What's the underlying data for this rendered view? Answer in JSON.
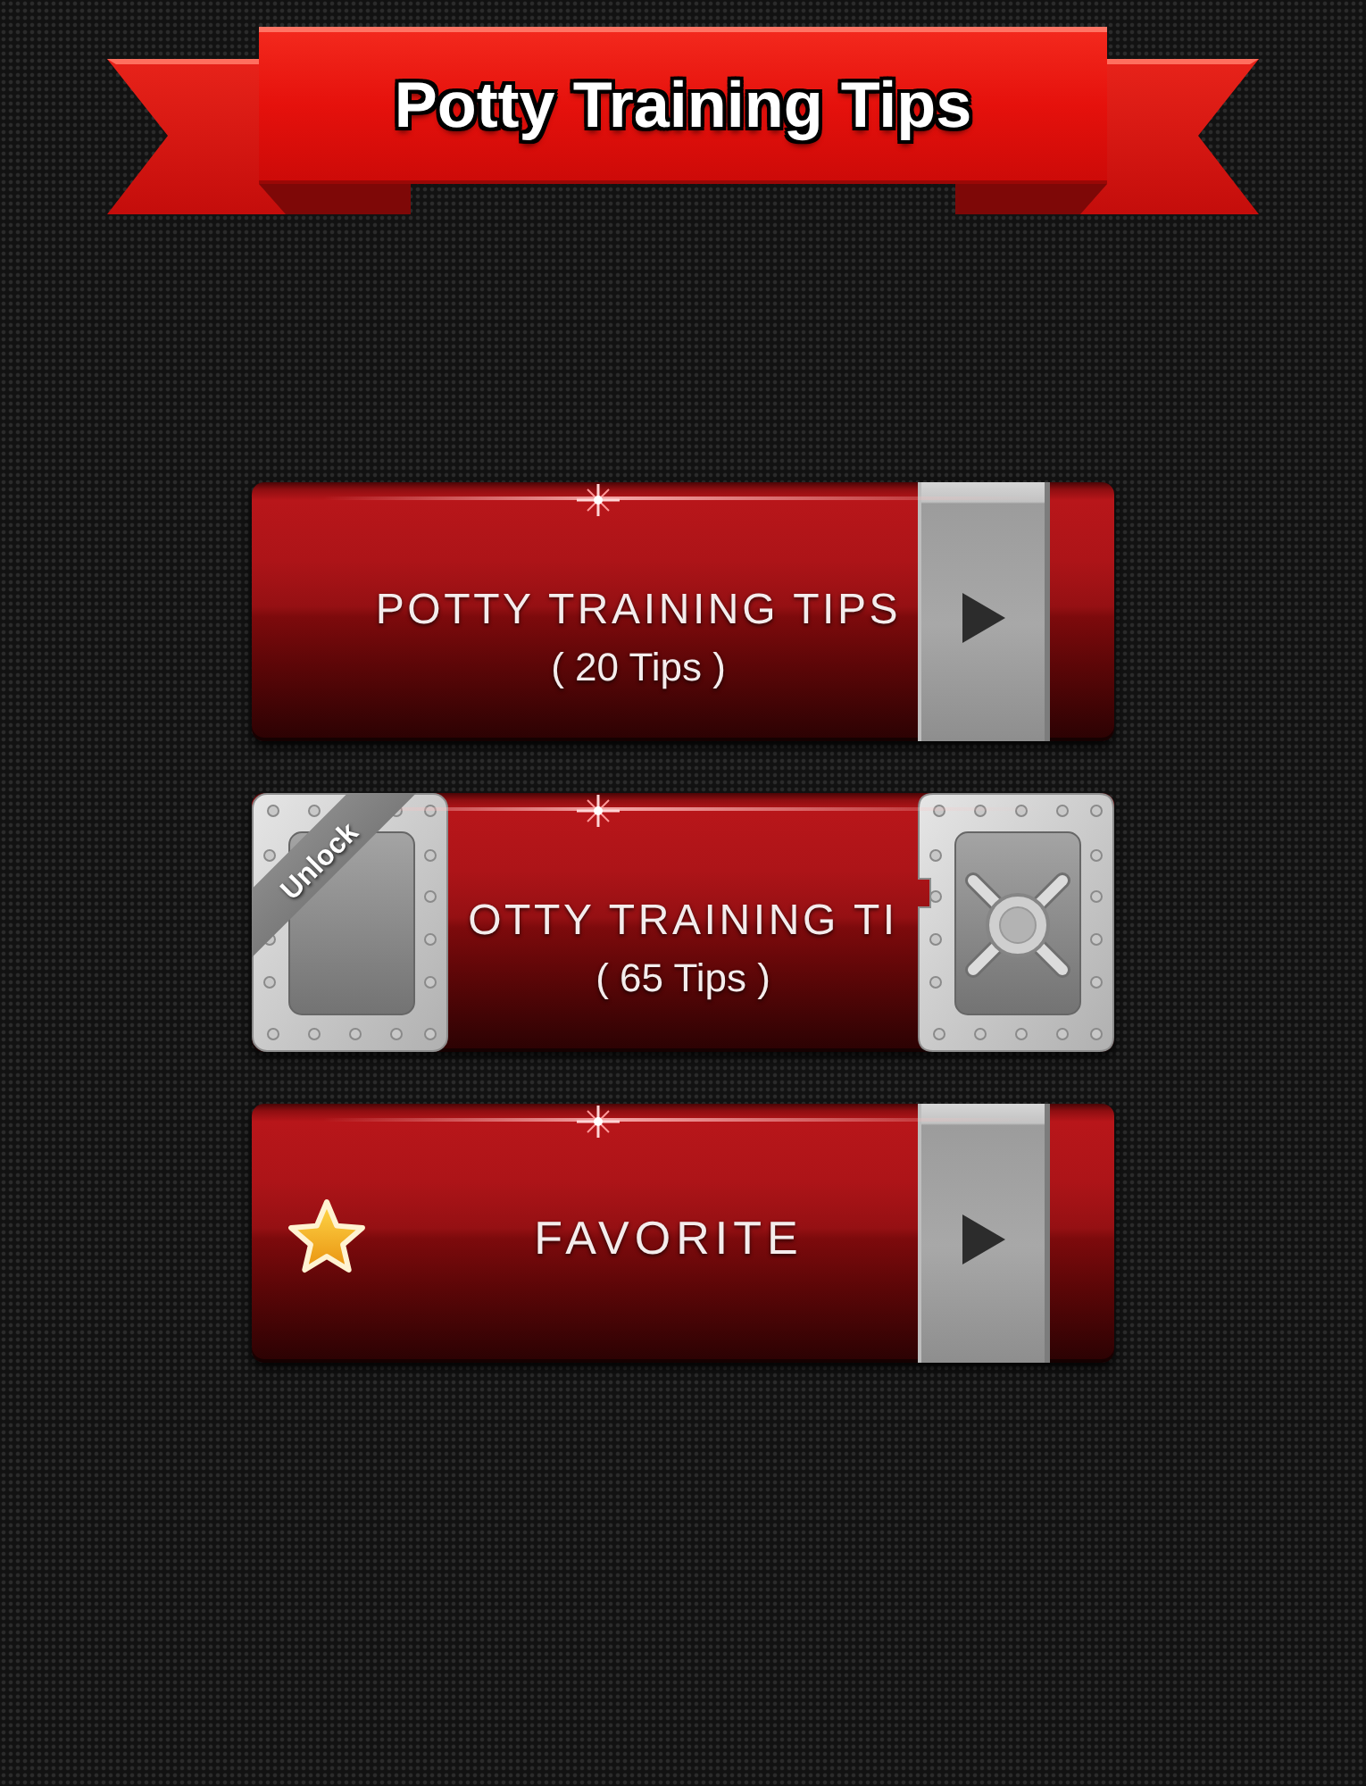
{
  "banner": {
    "title": "Potty Training Tips"
  },
  "menu": [
    {
      "kind": "tips",
      "title": "POTTY TRAINING TIPS",
      "count": "( 20 Tips )",
      "locked": false
    },
    {
      "kind": "tips",
      "title": "OTTY TRAINING TI",
      "count": "( 65 Tips )",
      "locked": true,
      "badge": "Unlock"
    },
    {
      "kind": "favorite",
      "title": "FAVORITE",
      "locked": false
    }
  ]
}
